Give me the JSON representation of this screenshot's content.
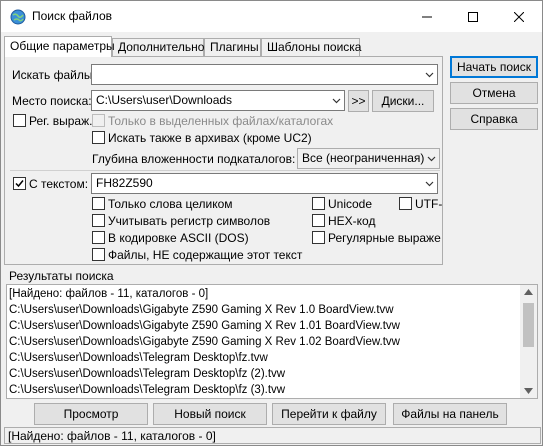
{
  "window": {
    "title": "Поиск файлов",
    "icon": "globe-search-icon"
  },
  "tabs": [
    {
      "label": "Общие параметры",
      "active": true
    },
    {
      "label": "Дополнительно",
      "active": false
    },
    {
      "label": "Плагины",
      "active": false
    },
    {
      "label": "Шаблоны поиска",
      "active": false
    }
  ],
  "general": {
    "search_files_label": "Искать файлы:",
    "search_files_value": "",
    "location_label": "Место поиска:",
    "location_value": "C:\\Users\\user\\Downloads",
    "arrows_button": ">>",
    "drives_button": "Диски...",
    "regex_label": "Рег. выраж.",
    "only_selected_label": "Только в выделенных файлах/каталогах",
    "search_archives_label": "Искать также в архивах (кроме UC2)",
    "depth_label": "Глубина вложенности подкаталогов:",
    "depth_value": "Все (неограниченная)",
    "with_text_label": "С текстом:",
    "with_text_checked": true,
    "text_value": "FH82Z590",
    "opt_whole_words": "Только слова целиком",
    "opt_case": "Учитывать регистр символов",
    "opt_ascii": "В кодировке ASCII (DOS)",
    "opt_not_containing": "Файлы, НЕ содержащие этот текст",
    "opt_unicode": "Unicode",
    "opt_hex": "HEX-код",
    "opt_regex": "Регулярные выраже",
    "opt_utf": "UTF-"
  },
  "side_buttons": {
    "start": "Начать поиск",
    "cancel": "Отмена",
    "help": "Справка"
  },
  "results": {
    "label": "Результаты поиска",
    "lines": [
      "[Найдено: файлов - 11, каталогов - 0]",
      "C:\\Users\\user\\Downloads\\Gigabyte Z590 Gaming X Rev 1.0 BoardView.tvw",
      "C:\\Users\\user\\Downloads\\Gigabyte Z590 Gaming X Rev 1.01 BoardView.tvw",
      "C:\\Users\\user\\Downloads\\Gigabyte Z590 Gaming X Rev 1.02 BoardView.tvw",
      "C:\\Users\\user\\Downloads\\Telegram Desktop\\fz.tvw",
      "C:\\Users\\user\\Downloads\\Telegram Desktop\\fz (2).tvw",
      "C:\\Users\\user\\Downloads\\Telegram Desktop\\fz (3).tvw"
    ]
  },
  "bottom_buttons": {
    "view": "Просмотр",
    "new_search": "Новый поиск",
    "goto_file": "Перейти к файлу",
    "to_panel": "Файлы на панель"
  },
  "status": "[Найдено: файлов - 11, каталогов - 0]",
  "colors": {
    "accent": "#0078d7",
    "window_bg": "#f0f0f0",
    "field_bg": "#ffffff"
  }
}
